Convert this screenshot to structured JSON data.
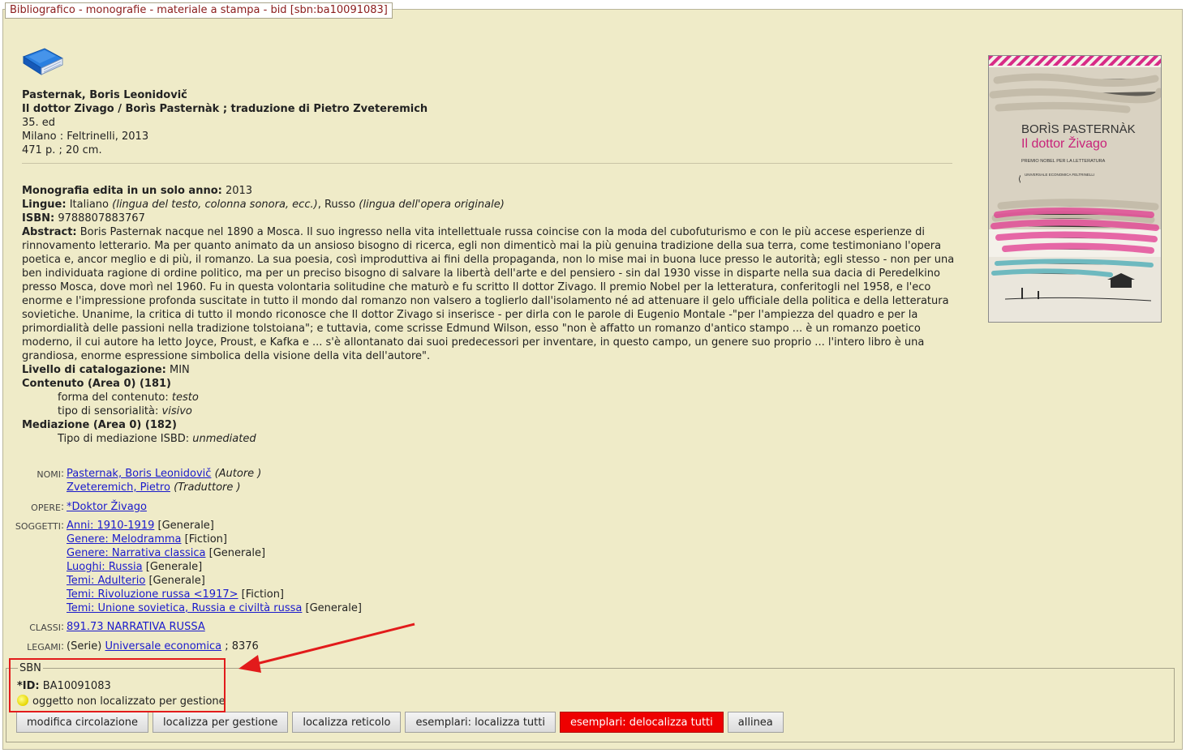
{
  "window": {
    "title": "Bibliografico - monografie - materiale a stampa - bid [sbn:ba10091083]"
  },
  "record": {
    "author": "Pasternak, Boris Leonidovič",
    "title": "Il dottor Zivago / Borìs Pasternàk ; traduzione di Pietro Zveteremich",
    "edition": "35. ed",
    "publication": "Milano : Feltrinelli, 2013",
    "physical": "471 p. ; 20 cm."
  },
  "details": {
    "monografia_label": "Monografia edita in un solo anno:",
    "monografia_value": "2013",
    "lingue_label": "Lingue:",
    "lingue_1": "Italiano",
    "lingue_1_note": "(lingua del testo, colonna sonora, ecc.)",
    "lingue_2": ", Russo",
    "lingue_2_note": "(lingua dell'opera originale)",
    "isbn_label": "ISBN:",
    "isbn_value": "9788807883767",
    "abstract_label": "Abstract:",
    "abstract_value": "Boris Pasternak nacque nel 1890 a Mosca. Il suo ingresso nella vita intellettuale russa coincise con la moda del cubofuturismo e con le più accese esperienze di rinnovamento letterario. Ma per quanto animato da un ansioso bisogno di ricerca, egli non dimenticò mai la più genuina tradizione della sua terra, come testimoniano l'opera poetica e, ancor meglio e di più, il romanzo. La sua poesia, così improduttiva ai fini della propaganda, non lo mise mai in buona luce presso le autorità; egli stesso - non per una ben individuata ragione di ordine politico, ma per un preciso bisogno di salvare la libertà dell'arte e del pensiero - sin dal 1930 visse in disparte nella sua dacia di Peredelkino presso Mosca, dove morì nel 1960. Fu in questa volontaria solitudine che maturò e fu scritto Il dottor Zivago. Il premio Nobel per la letteratura, conferitogli nel 1958, e l'eco enorme e l'impressione profonda suscitate in tutto il mondo dal romanzo non valsero a toglierlo dall'isolamento né ad attenuare il gelo ufficiale della politica e della letteratura sovietiche. Unanime, la critica di tutto il mondo riconosce che Il dottor Zivago si inserisce - per dirla con le parole di Eugenio Montale -\"per l'ampiezza del quadro e per la primordialità delle passioni nella tradizione tolstoiana\"; e tuttavia, come scrisse Edmund Wilson, esso \"non è affatto un romanzo d'antico stampo ... è un romanzo poetico moderno, il cui autore ha letto Joyce, Proust, e Kafka e ... s'è allontanato dai suoi predecessori per inventare, in questo campo, un genere suo proprio ... l'intero libro è una grandiosa, enorme espressione simbolica della visione della vita dell'autore\".",
    "livello_label": "Livello di catalogazione:",
    "livello_value": "MIN",
    "contenuto_header": "Contenuto (Area 0) (181)",
    "forma_label": "forma del contenuto:",
    "forma_value": "testo",
    "tipo_sens_label": "tipo di sensorialità:",
    "tipo_sens_value": "visivo",
    "mediazione_header": "Mediazione (Area 0) (182)",
    "tipo_med_label": "Tipo di mediazione ISBD:",
    "tipo_med_value": "unmediated"
  },
  "cover": {
    "author": "BORÌS PASTERNÀK",
    "title": "Il dottor Živago",
    "subtitle": "PREMIO NOBEL PER LA LETTERATURA",
    "series": "UNIVERSALE ECONOMICA FELTRINELLI"
  },
  "nomi": {
    "label": "NOMI",
    "items": [
      {
        "link": "Pasternak, Boris Leonidovič",
        "role": "(Autore )"
      },
      {
        "link": "Zveteremich, Pietro",
        "role": "(Traduttore )"
      }
    ]
  },
  "opere": {
    "label": "OPERE",
    "link": "*Doktor Živago"
  },
  "soggetti": {
    "label": "SOGGETTI",
    "items": [
      {
        "link": "Anni: 1910-1919",
        "tag": "[Generale]"
      },
      {
        "link": "Genere: Melodramma",
        "tag": "[Fiction]"
      },
      {
        "link": "Genere: Narrativa classica",
        "tag": "[Generale]"
      },
      {
        "link": "Luoghi: Russia",
        "tag": "[Generale]"
      },
      {
        "link": "Temi: Adulterio",
        "tag": "[Generale]"
      },
      {
        "link": "Temi: Rivoluzione russa <1917>",
        "tag": "[Fiction]"
      },
      {
        "link": "Temi: Unione sovietica, Russia e civiltà russa",
        "tag": "[Generale]"
      }
    ]
  },
  "classi": {
    "label": "CLASSI",
    "link": "891.73 NARRATIVA RUSSA"
  },
  "legami": {
    "label": "LEGAMI",
    "prefix": "(Serie)",
    "link": "Universale economica",
    "suffix": "; 8376"
  },
  "sbn": {
    "legend": "SBN",
    "id_label": "*ID:",
    "id_value": "BA10091083",
    "status_text": "oggetto non localizzato per gestione"
  },
  "buttons": {
    "modifica": "modifica circolazione",
    "localizza_gestione": "localizza per gestione",
    "localizza_reticolo": "localizza reticolo",
    "esemplari_localizza": "esemplari: localizza tutti",
    "esemplari_delocalizza": "esemplari: delocalizza tutti",
    "allinea": "allinea"
  },
  "colors": {
    "panel_bg": "#efebc8",
    "link": "#1a1acc",
    "highlight": "#e21b1b",
    "danger_button": "#ee0000"
  }
}
